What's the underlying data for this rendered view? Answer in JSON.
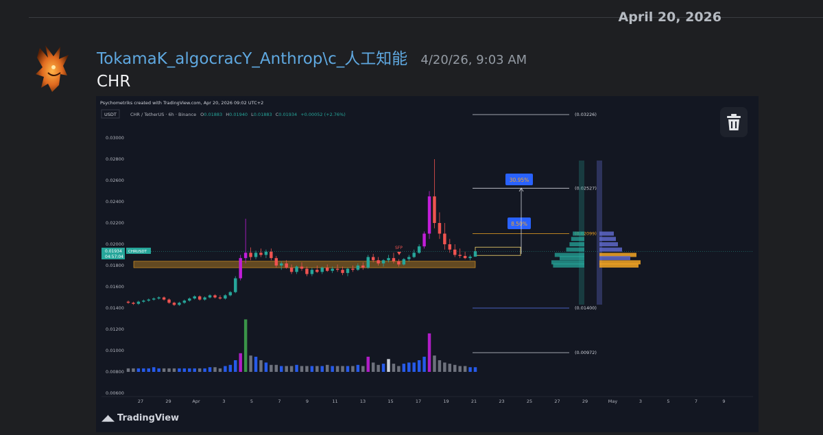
{
  "date_separator": "April 20, 2026",
  "message": {
    "username": "TokamaK_algocracY_Anthrop\\c_人工知能",
    "timestamp": "4/20/26, 9:03 AM",
    "text": "CHR"
  },
  "embed": {
    "created_with": "Psychometriks created with TradingView.com, Apr 20, 2026 09:02 UTC+2",
    "currency_tag": "USDT",
    "symbol_info": "CHR / TetherUS · 6h · Binance",
    "ohlc": {
      "o_label": "O",
      "o": "0.01883",
      "h_label": "H",
      "h": "0.01940",
      "l_label": "L",
      "l": "0.01883",
      "c_label": "C",
      "c": "0.01934",
      "change": "+0.00052 (+2.76%)"
    },
    "price_tag": {
      "price": "0.01934",
      "timer": "04:57:04",
      "symbol": "CHRUSDT"
    },
    "y_axis": [
      "0.03000",
      "0.02800",
      "0.02600",
      "0.02400",
      "0.02200",
      "0.02000",
      "0.01800",
      "0.01600",
      "0.01400",
      "0.01200",
      "0.01000",
      "0.00800",
      "0.00600"
    ],
    "x_axis": [
      "27",
      "29",
      "Apr",
      "3",
      "5",
      "7",
      "9",
      "11",
      "13",
      "15",
      "17",
      "19",
      "21",
      "23",
      "25",
      "27",
      "29",
      "May",
      "3",
      "5",
      "7",
      "9"
    ],
    "levels": [
      "(0.03226)",
      "(0.02527)",
      "(0.02099)",
      "(0.01400)",
      "(0.00972)"
    ],
    "targets": [
      "30.95%",
      "8.50%"
    ],
    "sfp_label": "SFP",
    "watermark": "TradingView",
    "icons": {
      "delete": "trash-icon",
      "avatar": "dragon-avatar",
      "brand": "tradingview-logo"
    },
    "colors": {
      "up": "#26a69a",
      "down": "#ef5350",
      "accent": "#2962ff",
      "zone": "#f5a623",
      "magenta": "#c21ed9"
    }
  },
  "chart_data": {
    "type": "candlestick",
    "timeframe": "6h",
    "ylim": [
      0.006,
      0.031
    ],
    "candles": [
      [
        0.0146,
        0.0147,
        0.0144,
        0.0145
      ],
      [
        0.0145,
        0.0146,
        0.0143,
        0.0144
      ],
      [
        0.0144,
        0.0147,
        0.0143,
        0.0146
      ],
      [
        0.0146,
        0.0148,
        0.0145,
        0.0147
      ],
      [
        0.0147,
        0.0149,
        0.0146,
        0.0148
      ],
      [
        0.0148,
        0.015,
        0.0147,
        0.0149
      ],
      [
        0.0149,
        0.0151,
        0.0148,
        0.015
      ],
      [
        0.015,
        0.0151,
        0.0147,
        0.0148
      ],
      [
        0.0148,
        0.0149,
        0.0144,
        0.0145
      ],
      [
        0.0145,
        0.0146,
        0.0142,
        0.0143
      ],
      [
        0.0143,
        0.0146,
        0.0142,
        0.0145
      ],
      [
        0.0145,
        0.0148,
        0.0144,
        0.0147
      ],
      [
        0.0147,
        0.015,
        0.0146,
        0.0149
      ],
      [
        0.0149,
        0.0152,
        0.0148,
        0.0151
      ],
      [
        0.0151,
        0.0152,
        0.0147,
        0.0148
      ],
      [
        0.0148,
        0.0151,
        0.0147,
        0.015
      ],
      [
        0.015,
        0.0153,
        0.0149,
        0.0152
      ],
      [
        0.0152,
        0.0153,
        0.0149,
        0.015
      ],
      [
        0.015,
        0.0152,
        0.0148,
        0.0149
      ],
      [
        0.0149,
        0.0153,
        0.0148,
        0.0152
      ],
      [
        0.0152,
        0.0156,
        0.0151,
        0.0155
      ],
      [
        0.0155,
        0.017,
        0.0154,
        0.0168
      ],
      [
        0.0168,
        0.019,
        0.0166,
        0.0187
      ],
      [
        0.0187,
        0.0224,
        0.0182,
        0.0192
      ],
      [
        0.0192,
        0.0197,
        0.0185,
        0.0188
      ],
      [
        0.0188,
        0.0194,
        0.0186,
        0.0192
      ],
      [
        0.0192,
        0.0196,
        0.0188,
        0.019
      ],
      [
        0.019,
        0.0195,
        0.0187,
        0.0193
      ],
      [
        0.0193,
        0.0196,
        0.0185,
        0.0187
      ],
      [
        0.0187,
        0.0189,
        0.0178,
        0.018
      ],
      [
        0.018,
        0.0184,
        0.0176,
        0.0182
      ],
      [
        0.0182,
        0.0185,
        0.0177,
        0.0178
      ],
      [
        0.0178,
        0.0181,
        0.0172,
        0.0174
      ],
      [
        0.0174,
        0.018,
        0.0172,
        0.0179
      ],
      [
        0.0179,
        0.0183,
        0.0175,
        0.0177
      ],
      [
        0.0177,
        0.0179,
        0.017,
        0.0172
      ],
      [
        0.0172,
        0.0178,
        0.017,
        0.0176
      ],
      [
        0.0176,
        0.018,
        0.0173,
        0.0174
      ],
      [
        0.0174,
        0.0179,
        0.0172,
        0.0178
      ],
      [
        0.0178,
        0.0181,
        0.0174,
        0.0175
      ],
      [
        0.0175,
        0.0179,
        0.0173,
        0.0177
      ],
      [
        0.0177,
        0.0181,
        0.0174,
        0.0176
      ],
      [
        0.0176,
        0.0179,
        0.0171,
        0.0173
      ],
      [
        0.0173,
        0.0178,
        0.017,
        0.0177
      ],
      [
        0.0177,
        0.018,
        0.0174,
        0.0176
      ],
      [
        0.0176,
        0.0182,
        0.0175,
        0.018
      ],
      [
        0.018,
        0.0183,
        0.0176,
        0.0178
      ],
      [
        0.0178,
        0.019,
        0.0177,
        0.0188
      ],
      [
        0.0188,
        0.0191,
        0.0183,
        0.0185
      ],
      [
        0.0185,
        0.0188,
        0.018,
        0.0182
      ],
      [
        0.0182,
        0.0186,
        0.0179,
        0.0185
      ],
      [
        0.0185,
        0.019,
        0.0183,
        0.0187
      ],
      [
        0.0187,
        0.0192,
        0.0182,
        0.0184
      ],
      [
        0.0184,
        0.0186,
        0.0179,
        0.0181
      ],
      [
        0.0181,
        0.0187,
        0.018,
        0.0186
      ],
      [
        0.0186,
        0.019,
        0.0184,
        0.0188
      ],
      [
        0.0188,
        0.0195,
        0.0187,
        0.0192
      ],
      [
        0.0192,
        0.02,
        0.0191,
        0.0198
      ],
      [
        0.0198,
        0.0212,
        0.0196,
        0.021
      ],
      [
        0.021,
        0.025,
        0.0205,
        0.0245
      ],
      [
        0.0245,
        0.028,
        0.0215,
        0.022
      ],
      [
        0.022,
        0.023,
        0.0205,
        0.021
      ],
      [
        0.021,
        0.022,
        0.0195,
        0.02
      ],
      [
        0.02,
        0.0205,
        0.0192,
        0.0195
      ],
      [
        0.0195,
        0.02,
        0.0188,
        0.019
      ],
      [
        0.019,
        0.0196,
        0.0187,
        0.0189
      ],
      [
        0.0189,
        0.0193,
        0.0186,
        0.0187
      ],
      [
        0.0187,
        0.019,
        0.0185,
        0.01883
      ],
      [
        0.01883,
        0.0194,
        0.01883,
        0.01934
      ]
    ],
    "volume": [
      0.3,
      0.3,
      0.3,
      0.3,
      0.3,
      0.4,
      0.3,
      0.3,
      0.3,
      0.3,
      0.3,
      0.3,
      0.3,
      0.3,
      0.3,
      0.3,
      0.4,
      0.4,
      0.3,
      0.5,
      0.6,
      1.0,
      1.6,
      4.5,
      1.4,
      1.3,
      1.0,
      0.8,
      0.6,
      0.6,
      0.5,
      0.5,
      0.5,
      0.6,
      0.5,
      0.5,
      0.5,
      0.5,
      0.5,
      0.6,
      0.5,
      0.5,
      0.5,
      0.5,
      0.5,
      0.6,
      0.5,
      1.3,
      0.8,
      0.6,
      0.7,
      1.1,
      0.7,
      0.5,
      0.7,
      0.8,
      0.8,
      1.0,
      1.3,
      3.3,
      1.4,
      1.0,
      0.8,
      0.7,
      0.6,
      0.5,
      0.5,
      0.4,
      0.4
    ],
    "volume_colors": {
      "23": "#3fa34d",
      "22": "#c21ed9",
      "47": "#c21ed9",
      "59": "#c21ed9",
      "51": "#e0e3eb"
    },
    "levels": [
      0.03226,
      0.02527,
      0.02099,
      0.014,
      0.00972
    ],
    "zone": [
      0.0178,
      0.0184
    ],
    "current_price": 0.01934,
    "volume_profile": [
      {
        "price": 0.021,
        "size": 0.35
      },
      {
        "price": 0.0205,
        "size": 0.4
      },
      {
        "price": 0.02,
        "size": 0.45
      },
      {
        "price": 0.0195,
        "size": 0.55
      },
      {
        "price": 0.019,
        "size": 0.9
      },
      {
        "price": 0.0187,
        "size": 0.75
      },
      {
        "price": 0.0183,
        "size": 1.0
      },
      {
        "price": 0.018,
        "size": 0.95
      }
    ]
  }
}
